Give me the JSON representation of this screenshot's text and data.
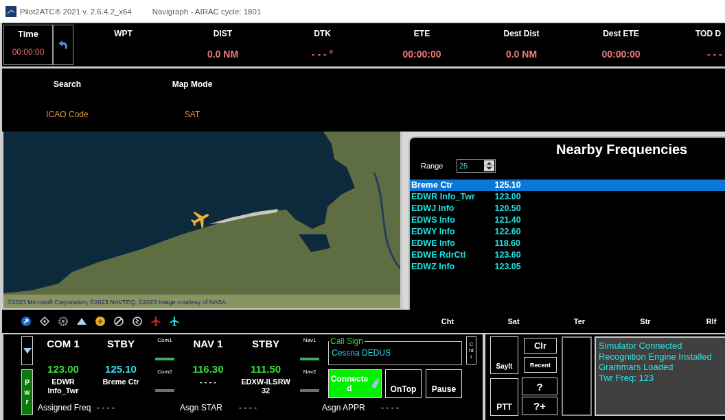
{
  "window": {
    "title": "Pilot2ATC® 2021 v. 2.6.4.2_x64",
    "subtitle": "Navigraph - AIRAC cycle: 1801"
  },
  "flight_bar": {
    "time": {
      "label": "Time",
      "value": "00:00:00"
    },
    "columns": [
      {
        "label": "WPT"
      },
      {
        "label": "DIST",
        "value": "0.0 NM"
      },
      {
        "label": "DTK",
        "value": "- - - °"
      },
      {
        "label": "ETE",
        "value": "00:00:00"
      },
      {
        "label": "Dest Dist",
        "value": "0.0 NM"
      },
      {
        "label": "Dest ETE",
        "value": "00:00:00"
      },
      {
        "label": "TOD D",
        "value": "- - -"
      }
    ]
  },
  "search_bar": [
    {
      "label": "Search",
      "value": "ICAO Code"
    },
    {
      "label": "Map Mode",
      "value": "SAT"
    }
  ],
  "map": {
    "attribution": "©2023 Microsoft Corporation, ©2023 NAVTEQ, ©2023 Image courtesy of NASA"
  },
  "nearby_frequencies": {
    "title": "Nearby Frequencies",
    "range": {
      "label": "Range",
      "value": "25"
    },
    "rows": [
      {
        "name": "Breme Ctr",
        "frequency": "125.10",
        "selected": true
      },
      {
        "name": "EDWR Info_Twr",
        "frequency": "123.00",
        "selected": false
      },
      {
        "name": "EDWJ Info",
        "frequency": "120.50",
        "selected": false
      },
      {
        "name": "EDWS Info",
        "frequency": "121.40",
        "selected": false
      },
      {
        "name": "EDWY Info",
        "frequency": "122.60",
        "selected": false
      },
      {
        "name": "EDWE Info",
        "frequency": "118.60",
        "selected": false
      },
      {
        "name": "EDWE RdrCtl",
        "frequency": "123.60",
        "selected": false
      },
      {
        "name": "EDWZ Info",
        "frequency": "123.05",
        "selected": false
      }
    ]
  },
  "map_layers": [
    "Cht",
    "Sat",
    "Ter",
    "Str",
    "Rlf"
  ],
  "radio_panel": {
    "power_button": "Pwr",
    "groups": [
      {
        "radios": [
          {
            "title": "COM 1",
            "frequency": "123.00",
            "station": "EDWR Info_Twr",
            "color": "#33e033"
          },
          {
            "title": "STBY",
            "frequency": "125.10",
            "station": "Breme Ctr",
            "color": "#33ddee"
          }
        ],
        "selectors": [
          {
            "label": "Com1",
            "selected": true
          },
          {
            "label": "Com2",
            "selected": false
          }
        ]
      },
      {
        "radios": [
          {
            "title": "NAV 1",
            "frequency": "116.30",
            "station": "- - - -",
            "color": "#33e033"
          },
          {
            "title": "STBY",
            "frequency": "111.50",
            "station": "EDXW-ILSRW 32",
            "color": "#33e033"
          }
        ],
        "selectors": [
          {
            "label": "Nav1",
            "selected": true
          },
          {
            "label": "Nav2",
            "selected": false
          }
        ]
      }
    ],
    "call_sign": {
      "label": "Call Sign",
      "value": "Cessna DEDUS"
    },
    "character_button": "Chtr",
    "buttons": [
      {
        "label": "Connected",
        "kind": "connect",
        "on": true
      },
      {
        "label": "OnTop",
        "kind": "plain"
      },
      {
        "label": "Pause",
        "kind": "plain"
      }
    ],
    "assignments": [
      {
        "label": "Assigned Freq",
        "value": "- - - -"
      },
      {
        "label": "Asgn STAR",
        "value": "- - - -"
      },
      {
        "label": "Asgn APPR",
        "value": "- - - -"
      }
    ]
  },
  "speech_controls": [
    {
      "main": "SayIt",
      "side": [
        "Clr",
        "Recent"
      ]
    },
    {
      "main": "PTT",
      "side": [
        "?",
        "?+"
      ]
    }
  ],
  "status_messages": [
    "Simulator Connected",
    "Recognition Engine Installed",
    "Grammars Loaded",
    "Twr Freq: 123"
  ]
}
